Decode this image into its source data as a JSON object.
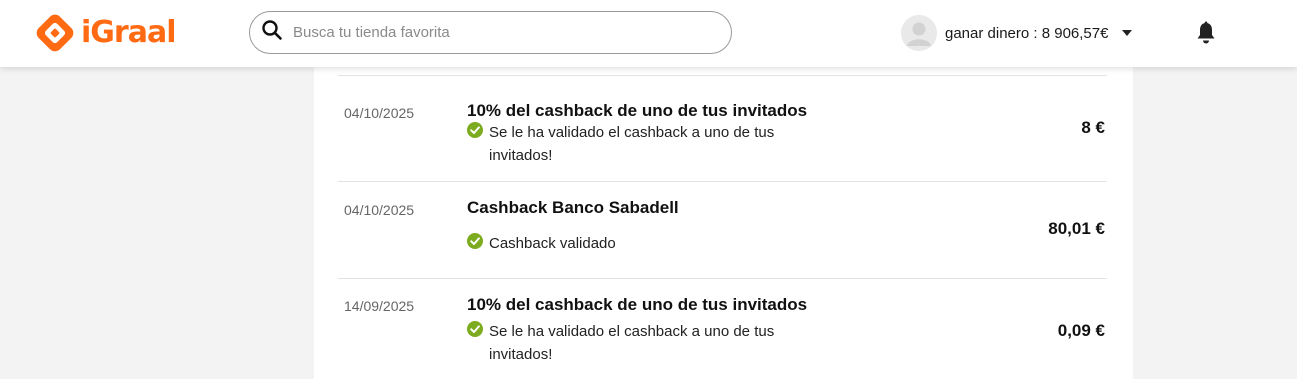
{
  "header": {
    "brand": "iGraal",
    "search_placeholder": "Busca tu tienda favorita",
    "balance_label": "ganar dinero : 8 906,57€",
    "icons": {
      "logo": "igraal-logo-icon",
      "search": "search-icon",
      "avatar": "avatar-icon",
      "caret": "caret-down-icon",
      "notifications": "bell-icon"
    }
  },
  "colors": {
    "brand_orange": "#ff6a13",
    "validated_green": "#7cab1f",
    "page_background": "#f3f3f3"
  },
  "transactions": [
    {
      "date": "04/10/2025",
      "title": "10% del cashback de uno de tus invitados",
      "status": "Se le ha validado el cashback a uno de tus invitados!",
      "amount": "8 €"
    },
    {
      "date": "04/10/2025",
      "title": "Cashback Banco Sabadell",
      "status": "Cashback validado",
      "amount": "80,01 €"
    },
    {
      "date": "14/09/2025",
      "title": "10% del cashback de uno de tus invitados",
      "status": "Se le ha validado el cashback a uno de tus invitados!",
      "amount": "0,09 €"
    }
  ]
}
